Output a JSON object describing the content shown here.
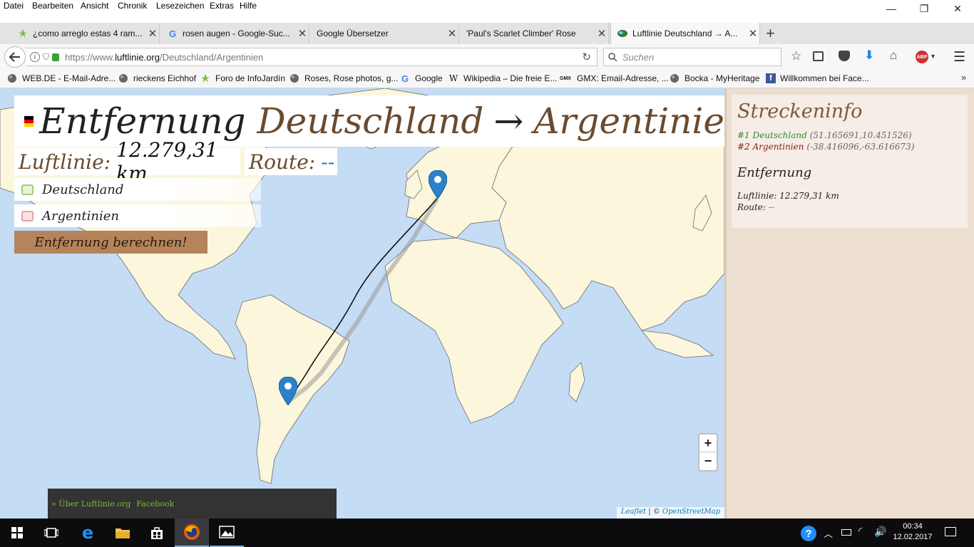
{
  "menu": [
    "Datei",
    "Bearbeiten",
    "Ansicht",
    "Chronik",
    "Lesezeichen",
    "Extras",
    "Hilfe"
  ],
  "window_controls": {
    "minimize": "—",
    "restore": "❐",
    "close": "✕"
  },
  "tabs": [
    {
      "label": "¿como arreglo estas 4 ram...",
      "icon": "infojardin-icon"
    },
    {
      "label": "rosen augen - Google-Suc...",
      "icon": "google-icon"
    },
    {
      "label": "Google Übersetzer",
      "icon": "none"
    },
    {
      "label": "'Paul's Scarlet Climber' Rose",
      "icon": "none"
    },
    {
      "label": "Luftlinie Deutschland → A...",
      "icon": "luftlinie-icon"
    }
  ],
  "new_tab": "+",
  "url": {
    "prefix": "https://www.",
    "domain": "luftlinie.org",
    "path": "/Deutschland/Argentinien"
  },
  "search": {
    "placeholder": "Suchen"
  },
  "bookmarks": [
    {
      "label": "WEB.DE - E-Mail-Adre...",
      "icon": "globe-icon"
    },
    {
      "label": "rieckens Eichhof",
      "icon": "globe-icon"
    },
    {
      "label": "Foro de InfoJardín",
      "icon": "infojardin-icon"
    },
    {
      "label": "Roses, Rose photos, g...",
      "icon": "globe-icon"
    },
    {
      "label": "Google",
      "icon": "google-icon"
    },
    {
      "label": "Wikipedia – Die freie E...",
      "icon": "wikipedia-icon"
    },
    {
      "label": "GMX: Email-Adresse, ...",
      "icon": "gmx-icon"
    },
    {
      "label": "Bocka - MyHeritage",
      "icon": "globe-icon"
    },
    {
      "label": "Willkommen bei Face...",
      "icon": "facebook-icon"
    }
  ],
  "bookmarks_more": "»",
  "page": {
    "title_prefix": "Entfernung",
    "title_from": "Deutschland",
    "title_arrow": "→",
    "title_to": "Argentinie",
    "luftlinie_label": "Luftlinie:",
    "luftlinie_value": "12.279,31 km",
    "route_label": "Route:",
    "route_value": "--",
    "from_input": "Deutschland",
    "to_input": "Argentinien",
    "calc_button": "Entfernung berechnen!",
    "footer_link1": "» Über Luftlinie.org",
    "footer_link2": "Facebook",
    "zoom_in": "+",
    "zoom_out": "−",
    "attribution_leaflet": "Leaflet",
    "attribution_sep": " | © ",
    "attribution_osm": "OpenStreetMap"
  },
  "sidebar": {
    "title": "Streckeninfo",
    "point1_label": "#1 Deutschland",
    "point1_coords": "(51.165691,10.451526)",
    "point2_label": "#2 Argentinien",
    "point2_coords": "(-38.416096,-63.616673)",
    "dist_title": "Entfernung",
    "luft_line": "Luftlinie: 12.279,31 km",
    "route_label": "Route:",
    "route_value": "--"
  },
  "taskbar": {
    "time": "00:34",
    "date": "12.02.2017"
  },
  "colors": {
    "accent": "#b5845b",
    "map_water": "#c4dcf4",
    "land": "#fbf6dc",
    "marker": "#2a82cb",
    "sidebar_bg": "#ecdfd0"
  }
}
